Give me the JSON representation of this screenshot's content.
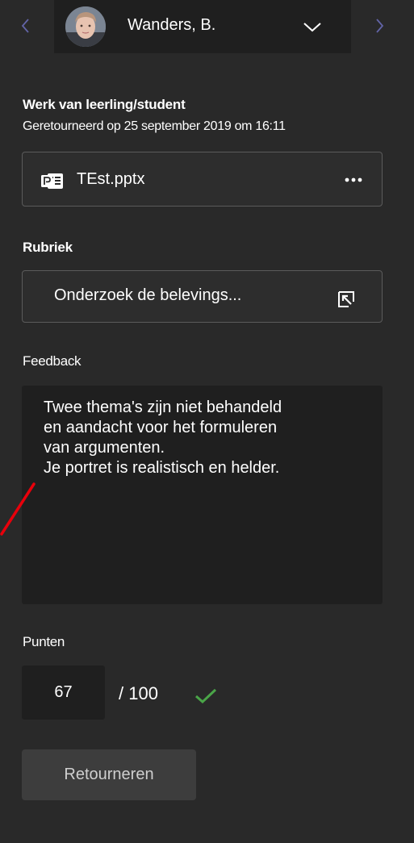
{
  "header": {
    "student_name": "Wanders, B.",
    "prev_icon": "chevron-left-icon",
    "next_icon": "chevron-right-icon",
    "dropdown_icon": "chevron-down-icon"
  },
  "work": {
    "title": "Werk van leerling/student",
    "status": "Geretourneerd op 25 september 2019 om 16:11",
    "file": {
      "name": "TEst.pptx",
      "icon": "powerpoint-icon",
      "more_label": "•••"
    }
  },
  "rubric": {
    "title": "Rubriek",
    "button_label": "Onderzoek de belevings...",
    "icon": "expand-icon"
  },
  "feedback": {
    "title": "Feedback",
    "lines": [
      "Twee thema's zijn niet behandeld",
      "en aandacht voor het formuleren",
      "van argumenten.",
      "Je portret is realistisch en helder."
    ]
  },
  "points": {
    "title": "Punten",
    "value": "67",
    "max": "/ 100",
    "status_icon": "checkmark-icon"
  },
  "actions": {
    "return_label": "Retourneren"
  },
  "colors": {
    "background": "#292929",
    "surface": "#1f1f1f",
    "nav_arrow": "#6264a7",
    "check": "#4aa548",
    "annotation": "#e8000b"
  }
}
